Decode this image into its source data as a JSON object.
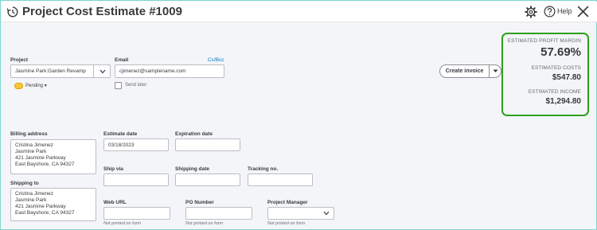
{
  "header": {
    "title": "Project Cost Estimate #1009",
    "help_label": "Help"
  },
  "customer": {
    "label": "Project",
    "value": "Jasmine Park:Garden Revamp"
  },
  "email": {
    "label": "Email",
    "value": "cjimenez@samplename.com",
    "cc_bcc": "Cc/Bcc",
    "send_later": "Send later"
  },
  "status": {
    "label": "Pending",
    "color": "#f8c53a"
  },
  "actions": {
    "create_invoice": "Create invoice"
  },
  "summary": {
    "margin_label": "ESTIMATED PROFIT MARGIN",
    "margin_value": "57.69%",
    "costs_label": "ESTIMATED COSTS",
    "costs_value": "$547.80",
    "income_label": "ESTIMATED INCOME",
    "income_value": "$1,294.80",
    "border_color": "#2ca01c"
  },
  "billing": {
    "label": "Billing address",
    "lines": [
      "Cristina Jimenez",
      "Jasmine Park",
      "421 Jasmine Parkway",
      "East Bayshore, CA  94327"
    ]
  },
  "shipping_to": {
    "label": "Shipping to",
    "lines": [
      "Cristina Jimenez",
      "Jasmine Park",
      "421 Jasmine Parkway",
      "East Bayshore, CA  94327"
    ]
  },
  "dates": {
    "estimate_label": "Estimate date",
    "estimate_value": "03/18/2023",
    "expiration_label": "Expiration date",
    "expiration_value": ""
  },
  "shipping": {
    "via_label": "Ship via",
    "date_label": "Shipping date",
    "tracking_label": "Tracking no."
  },
  "extra": {
    "web_url_label": "Web URL",
    "po_label": "PO Number",
    "pm_label": "Project Manager",
    "not_printed": "Not printed on form"
  }
}
